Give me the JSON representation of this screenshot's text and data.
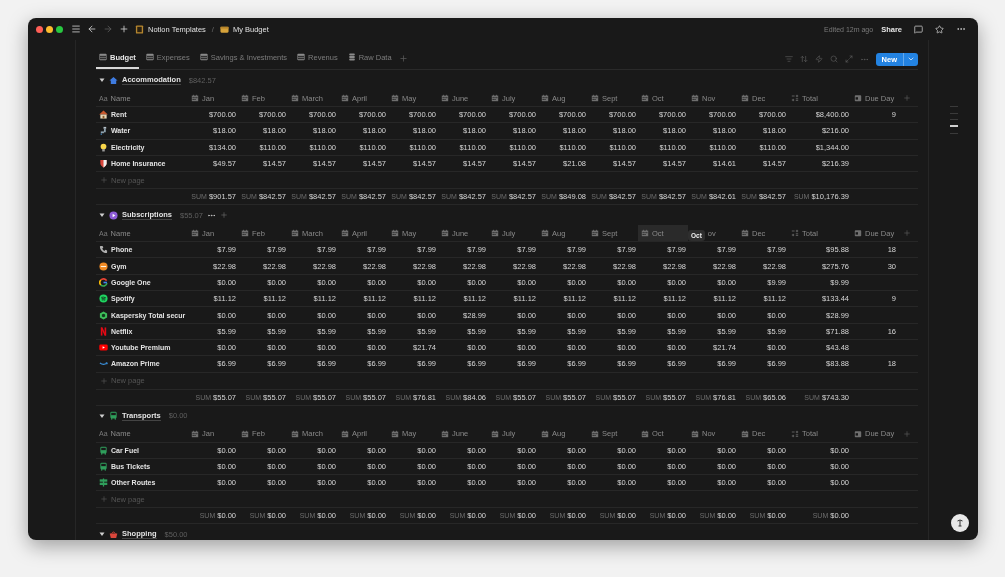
{
  "window": {
    "breadcrumb": [
      {
        "kind": "notion",
        "label": "Notion Templates"
      },
      {
        "kind": "wallet",
        "label": "My Budget"
      }
    ],
    "separator": "/",
    "edited": "Edited 12m ago",
    "share": "Share"
  },
  "tabs": [
    {
      "label": "Budget",
      "kind": "table",
      "selected": true
    },
    {
      "label": "Expenses",
      "kind": "table",
      "selected": false
    },
    {
      "label": "Savings & Investments",
      "kind": "table",
      "selected": false
    },
    {
      "label": "Revenus",
      "kind": "table",
      "selected": false
    },
    {
      "label": "Raw Data",
      "kind": "list",
      "selected": false
    }
  ],
  "new_button": "New",
  "sections": [
    {
      "name": "Accommodation",
      "kind": "house",
      "total": "$842.57",
      "hovered": false,
      "columns": [
        {
          "label": "Name",
          "kind": "title",
          "glyph": "Aa",
          "hovered": false
        },
        {
          "label": "Jan",
          "kind": "date",
          "hovered": false
        },
        {
          "label": "Feb",
          "kind": "date",
          "hovered": false
        },
        {
          "label": "March",
          "kind": "date",
          "hovered": false
        },
        {
          "label": "April",
          "kind": "date",
          "hovered": false
        },
        {
          "label": "May",
          "kind": "date",
          "hovered": false
        },
        {
          "label": "June",
          "kind": "date",
          "hovered": false
        },
        {
          "label": "July",
          "kind": "date",
          "hovered": false
        },
        {
          "label": "Aug",
          "kind": "date",
          "hovered": false
        },
        {
          "label": "Sept",
          "kind": "date",
          "hovered": false
        },
        {
          "label": "Oct",
          "kind": "date",
          "hovered": false
        },
        {
          "label": "Nov",
          "kind": "date",
          "hovered": false
        },
        {
          "label": "Dec",
          "kind": "date",
          "hovered": false
        },
        {
          "label": "Total",
          "kind": "formula",
          "hovered": false
        },
        {
          "label": "Due Day",
          "kind": "number",
          "hovered": false
        }
      ],
      "rows": [
        {
          "kind": "house",
          "name": "Rent",
          "values": [
            "$700.00",
            "$700.00",
            "$700.00",
            "$700.00",
            "$700.00",
            "$700.00",
            "$700.00",
            "$700.00",
            "$700.00",
            "$700.00",
            "$700.00",
            "$700.00"
          ],
          "total": "$8,400.00",
          "due": "9"
        },
        {
          "kind": "faucet",
          "name": "Water",
          "values": [
            "$18.00",
            "$18.00",
            "$18.00",
            "$18.00",
            "$18.00",
            "$18.00",
            "$18.00",
            "$18.00",
            "$18.00",
            "$18.00",
            "$18.00",
            "$18.00"
          ],
          "total": "$216.00"
        },
        {
          "kind": "bulb",
          "name": "Electricity",
          "values": [
            "$134.00",
            "$110.00",
            "$110.00",
            "$110.00",
            "$110.00",
            "$110.00",
            "$110.00",
            "$110.00",
            "$110.00",
            "$110.00",
            "$110.00",
            "$110.00"
          ],
          "total": "$1,344.00"
        },
        {
          "kind": "shield",
          "name": "Home Insurance",
          "values": [
            "$49.57",
            "$14.57",
            "$14.57",
            "$14.57",
            "$14.57",
            "$14.57",
            "$14.57",
            "$21.08",
            "$14.57",
            "$14.57",
            "$14.61",
            "$14.57"
          ],
          "total": "$216.39"
        }
      ],
      "new_row": "New page",
      "sums": [
        [
          "SUM",
          "$901.57"
        ],
        [
          "SUM",
          "$842.57"
        ],
        [
          "SUM",
          "$842.57"
        ],
        [
          "SUM",
          "$842.57"
        ],
        [
          "SUM",
          "$842.57"
        ],
        [
          "SUM",
          "$842.57"
        ],
        [
          "SUM",
          "$842.57"
        ],
        [
          "SUM",
          "$849.08"
        ],
        [
          "SUM",
          "$842.57"
        ],
        [
          "SUM",
          "$842.57"
        ],
        [
          "SUM",
          "$842.61"
        ],
        [
          "SUM",
          "$842.57"
        ],
        [
          "SUM",
          "$10,176.39"
        ]
      ]
    },
    {
      "name": "Subscriptions",
      "kind": "play",
      "total": "$55.07",
      "hovered": true,
      "columns": [
        {
          "label": "Name",
          "kind": "title",
          "glyph": "Aa",
          "hovered": false
        },
        {
          "label": "Jan",
          "kind": "date",
          "hovered": false
        },
        {
          "label": "Feb",
          "kind": "date",
          "hovered": false
        },
        {
          "label": "March",
          "kind": "date",
          "hovered": false
        },
        {
          "label": "April",
          "kind": "date",
          "hovered": false
        },
        {
          "label": "May",
          "kind": "date",
          "hovered": false
        },
        {
          "label": "June",
          "kind": "date",
          "hovered": false
        },
        {
          "label": "July",
          "kind": "date",
          "hovered": false
        },
        {
          "label": "Aug",
          "kind": "date",
          "hovered": false
        },
        {
          "label": "Sept",
          "kind": "date",
          "hovered": false
        },
        {
          "label": "Oct",
          "kind": "date",
          "hovered": true
        },
        {
          "label": "ov",
          "hovered": false,
          "tooltip": "Oct"
        },
        {
          "label": "Dec",
          "kind": "date",
          "hovered": false
        },
        {
          "label": "Total",
          "kind": "formula",
          "hovered": false
        },
        {
          "label": "Due Day",
          "kind": "number",
          "hovered": false
        }
      ],
      "rows": [
        {
          "kind": "phone",
          "name": "Phone",
          "values": [
            "$7.99",
            "$7.99",
            "$7.99",
            "$7.99",
            "$7.99",
            "$7.99",
            "$7.99",
            "$7.99",
            "$7.99",
            "$7.99",
            "$7.99",
            "$7.99"
          ],
          "total": "$95.88",
          "due": "18"
        },
        {
          "kind": "gym",
          "name": "Gym",
          "values": [
            "$22.98",
            "$22.98",
            "$22.98",
            "$22.98",
            "$22.98",
            "$22.98",
            "$22.98",
            "$22.98",
            "$22.98",
            "$22.98",
            "$22.98",
            "$22.98"
          ],
          "total": "$275.76",
          "due": "30"
        },
        {
          "kind": "google",
          "name": "Google One",
          "values": [
            "$0.00",
            "$0.00",
            "$0.00",
            "$0.00",
            "$0.00",
            "$0.00",
            "$0.00",
            "$0.00",
            "$0.00",
            "$0.00",
            "$0.00",
            "$9.99"
          ],
          "total": "$9.99"
        },
        {
          "kind": "spotify",
          "name": "Spotify",
          "values": [
            "$11.12",
            "$11.12",
            "$11.12",
            "$11.12",
            "$11.12",
            "$11.12",
            "$11.12",
            "$11.12",
            "$11.12",
            "$11.12",
            "$11.12",
            "$11.12"
          ],
          "total": "$133.44",
          "due": "9"
        },
        {
          "kind": "hexagon",
          "name": "Kaspersky Total secur",
          "values": [
            "$0.00",
            "$0.00",
            "$0.00",
            "$0.00",
            "$0.00",
            "$28.99",
            "$0.00",
            "$0.00",
            "$0.00",
            "$0.00",
            "$0.00",
            "$0.00"
          ],
          "total": "$28.99"
        },
        {
          "kind": "netflix",
          "name": "Netflix",
          "values": [
            "$5.99",
            "$5.99",
            "$5.99",
            "$5.99",
            "$5.99",
            "$5.99",
            "$5.99",
            "$5.99",
            "$5.99",
            "$5.99",
            "$5.99",
            "$5.99"
          ],
          "total": "$71.88",
          "due": "16"
        },
        {
          "kind": "youtube",
          "name": "Youtube Premium",
          "values": [
            "$0.00",
            "$0.00",
            "$0.00",
            "$0.00",
            "$21.74",
            "$0.00",
            "$0.00",
            "$0.00",
            "$0.00",
            "$0.00",
            "$21.74",
            "$0.00"
          ],
          "total": "$43.48"
        },
        {
          "kind": "smile",
          "name": "Amazon Prime",
          "values": [
            "$6.99",
            "$6.99",
            "$6.99",
            "$6.99",
            "$6.99",
            "$6.99",
            "$6.99",
            "$6.99",
            "$6.99",
            "$6.99",
            "$6.99",
            "$6.99"
          ],
          "total": "$83.88",
          "due": "18"
        }
      ],
      "new_row": "New page",
      "sums": [
        [
          "SUM",
          "$55.07"
        ],
        [
          "SUM",
          "$55.07"
        ],
        [
          "SUM",
          "$55.07"
        ],
        [
          "SUM",
          "$55.07"
        ],
        [
          "SUM",
          "$76.81"
        ],
        [
          "SUM",
          "$84.06"
        ],
        [
          "SUM",
          "$55.07"
        ],
        [
          "SUM",
          "$55.07"
        ],
        [
          "SUM",
          "$55.07"
        ],
        [
          "SUM",
          "$55.07"
        ],
        [
          "SUM",
          "$76.81"
        ],
        [
          "SUM",
          "$65.06"
        ],
        [
          "SUM",
          "$743.30"
        ]
      ]
    },
    {
      "name": "Transports",
      "kind": "bus",
      "total": "$0.00",
      "hovered": false,
      "columns": [
        {
          "label": "Name",
          "kind": "title",
          "glyph": "Aa",
          "hovered": false
        },
        {
          "label": "Jan",
          "kind": "date",
          "hovered": false
        },
        {
          "label": "Feb",
          "kind": "date",
          "hovered": false
        },
        {
          "label": "March",
          "kind": "date",
          "hovered": false
        },
        {
          "label": "April",
          "kind": "date",
          "hovered": false
        },
        {
          "label": "May",
          "kind": "date",
          "hovered": false
        },
        {
          "label": "June",
          "kind": "date",
          "hovered": false
        },
        {
          "label": "July",
          "kind": "date",
          "hovered": false
        },
        {
          "label": "Aug",
          "kind": "date",
          "hovered": false
        },
        {
          "label": "Sept",
          "kind": "date",
          "hovered": false
        },
        {
          "label": "Oct",
          "kind": "date",
          "hovered": false
        },
        {
          "label": "Nov",
          "kind": "date",
          "hovered": false
        },
        {
          "label": "Dec",
          "kind": "date",
          "hovered": false
        },
        {
          "label": "Total",
          "kind": "formula",
          "hovered": false
        },
        {
          "label": "Due Day",
          "kind": "number",
          "hovered": false
        }
      ],
      "rows": [
        {
          "kind": "bus",
          "name": "Car Fuel",
          "values": [
            "$0.00",
            "$0.00",
            "$0.00",
            "$0.00",
            "$0.00",
            "$0.00",
            "$0.00",
            "$0.00",
            "$0.00",
            "$0.00",
            "$0.00",
            "$0.00"
          ],
          "total": "$0.00"
        },
        {
          "kind": "bus",
          "name": "Bus Tickets",
          "values": [
            "$0.00",
            "$0.00",
            "$0.00",
            "$0.00",
            "$0.00",
            "$0.00",
            "$0.00",
            "$0.00",
            "$0.00",
            "$0.00",
            "$0.00",
            "$0.00"
          ],
          "total": "$0.00"
        },
        {
          "kind": "sign",
          "name": "Other Routes",
          "values": [
            "$0.00",
            "$0.00",
            "$0.00",
            "$0.00",
            "$0.00",
            "$0.00",
            "$0.00",
            "$0.00",
            "$0.00",
            "$0.00",
            "$0.00",
            "$0.00"
          ],
          "total": "$0.00"
        }
      ],
      "new_row": "New page",
      "sums": [
        [
          "SUM",
          "$0.00"
        ],
        [
          "SUM",
          "$0.00"
        ],
        [
          "SUM",
          "$0.00"
        ],
        [
          "SUM",
          "$0.00"
        ],
        [
          "SUM",
          "$0.00"
        ],
        [
          "SUM",
          "$0.00"
        ],
        [
          "SUM",
          "$0.00"
        ],
        [
          "SUM",
          "$0.00"
        ],
        [
          "SUM",
          "$0.00"
        ],
        [
          "SUM",
          "$0.00"
        ],
        [
          "SUM",
          "$0.00"
        ],
        [
          "SUM",
          "$0.00"
        ],
        [
          "SUM",
          "$0.00"
        ]
      ]
    },
    {
      "name": "Shopping",
      "kind": "basket",
      "total": "$50.00",
      "hovered": false
    }
  ]
}
